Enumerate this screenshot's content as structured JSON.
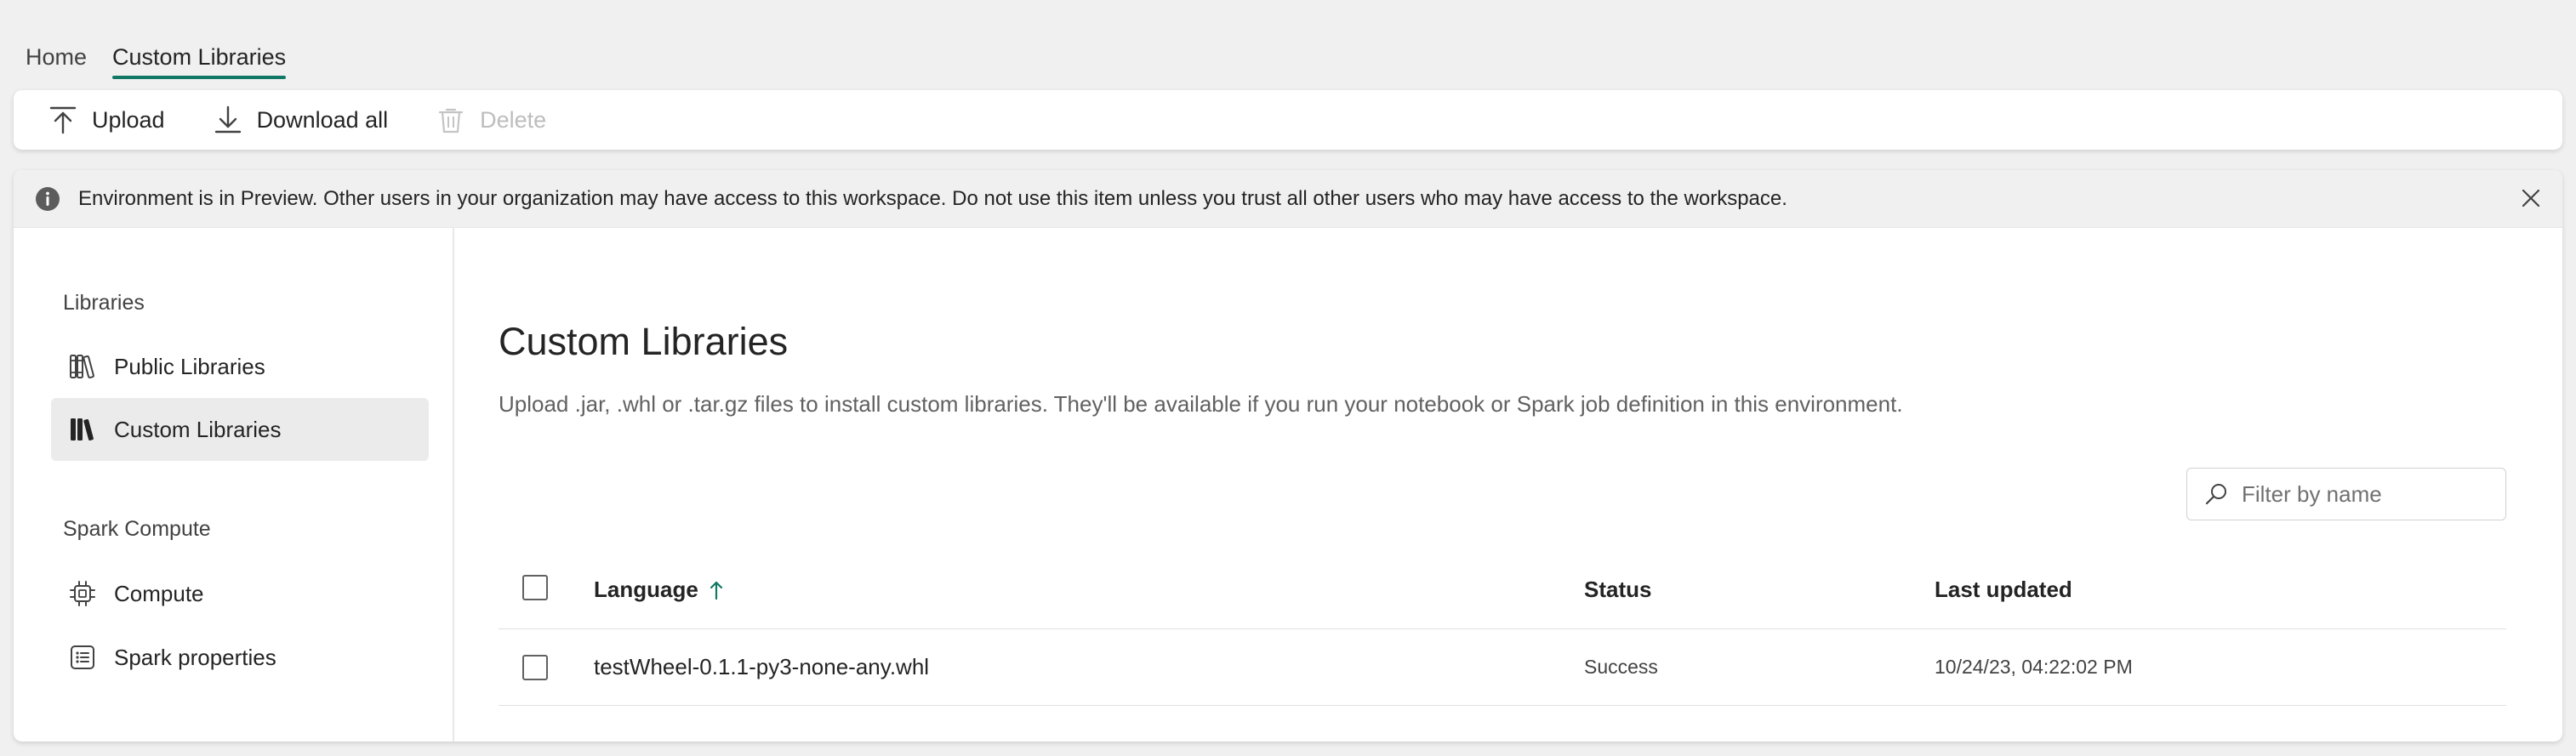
{
  "tabs": [
    {
      "label": "Home"
    },
    {
      "label": "Custom Libraries"
    }
  ],
  "toolbar": {
    "upload_label": "Upload",
    "download_all_label": "Download all",
    "delete_label": "Delete"
  },
  "banner": {
    "message": "Environment is in Preview. Other users in your organization may have access to this workspace. Do not use this item unless you trust all other users who may have access to the workspace."
  },
  "sidebar": {
    "libraries_section": "Libraries",
    "public_libraries": "Public Libraries",
    "custom_libraries": "Custom Libraries",
    "spark_compute_section": "Spark Compute",
    "compute": "Compute",
    "spark_properties": "Spark properties"
  },
  "main": {
    "title": "Custom Libraries",
    "description": "Upload .jar, .whl or .tar.gz files to install custom libraries. They'll be available if you run your notebook or Spark job definition in this environment.",
    "filter_placeholder": "Filter by name"
  },
  "table": {
    "columns": {
      "language": "Language",
      "status": "Status",
      "last_updated": "Last updated"
    },
    "rows": [
      {
        "name": "testWheel-0.1.1-py3-none-any.whl",
        "status": "Success",
        "last_updated": "10/24/23, 04:22:02 PM"
      }
    ]
  },
  "colors": {
    "accent": "#117865",
    "sort_arrow": "#117865"
  }
}
